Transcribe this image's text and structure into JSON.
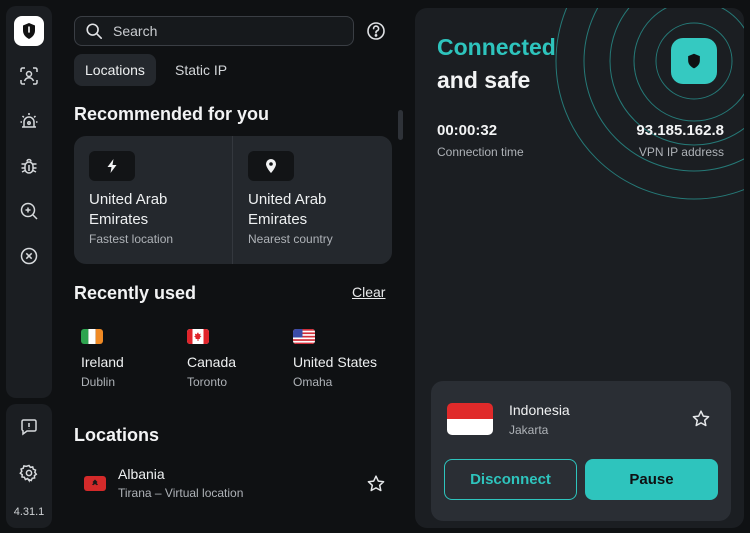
{
  "app": {
    "version": "4.31.1"
  },
  "sidebar": {
    "items": [
      {
        "icon": "shield-icon",
        "active": true
      },
      {
        "icon": "user-scan-icon"
      },
      {
        "icon": "alarm-icon"
      },
      {
        "icon": "bug-icon"
      },
      {
        "icon": "search-zoom-icon"
      },
      {
        "icon": "close-circle-icon"
      }
    ],
    "bottom": [
      {
        "icon": "feedback-icon"
      },
      {
        "icon": "settings-icon"
      }
    ]
  },
  "search": {
    "placeholder": "Search"
  },
  "tabs": [
    {
      "label": "Locations",
      "active": true
    },
    {
      "label": "Static IP",
      "active": false
    }
  ],
  "recommended": {
    "title": "Recommended for you",
    "items": [
      {
        "icon": "lightning-icon",
        "name": "United Arab Emirates",
        "sub": "Fastest location"
      },
      {
        "icon": "location-pin-icon",
        "name": "United Arab Emirates",
        "sub": "Nearest country"
      }
    ]
  },
  "recent": {
    "title": "Recently used",
    "clear_label": "Clear",
    "items": [
      {
        "country": "Ireland",
        "city": "Dublin"
      },
      {
        "country": "Canada",
        "city": "Toronto"
      },
      {
        "country": "United States",
        "city": "Omaha"
      }
    ]
  },
  "locations": {
    "title": "Locations",
    "items": [
      {
        "country": "Albania",
        "sub": "Tirana – Virtual location"
      }
    ]
  },
  "connection": {
    "status_line1": "Connected",
    "status_line2": "and safe",
    "time_value": "00:00:32",
    "time_label": "Connection time",
    "ip_value": "93.185.162.8",
    "ip_label": "VPN IP address"
  },
  "server": {
    "country": "Indonesia",
    "city": "Jakarta",
    "disconnect_label": "Disconnect",
    "pause_label": "Pause"
  },
  "colors": {
    "accent": "#2ec4bd",
    "panel": "#1b1e22",
    "card": "#24282d"
  }
}
